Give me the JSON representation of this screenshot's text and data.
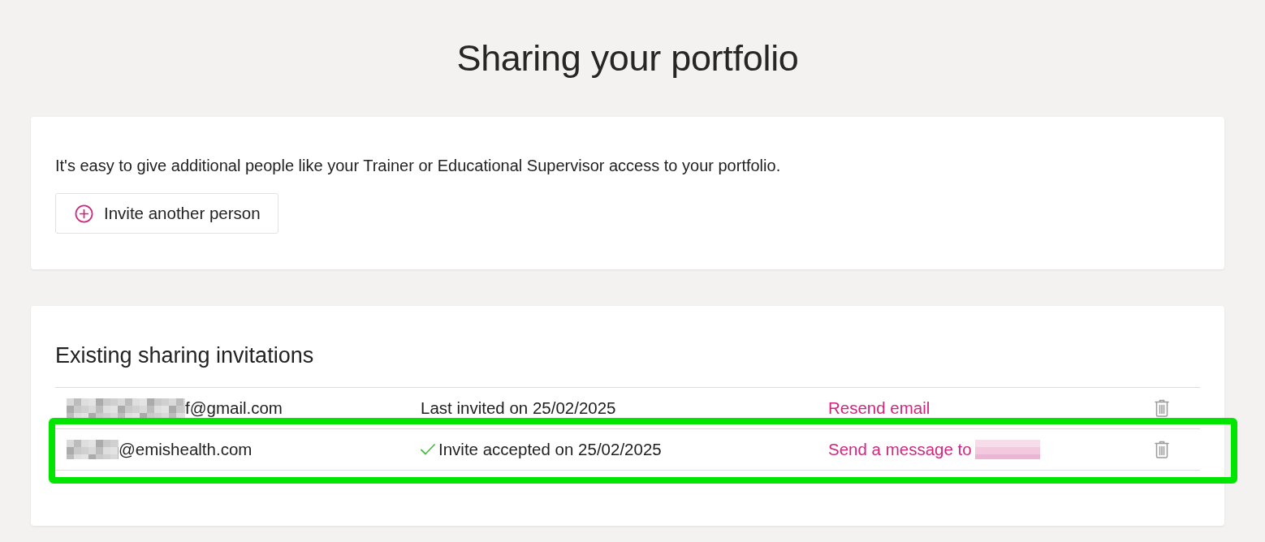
{
  "page": {
    "title": "Sharing your portfolio"
  },
  "intro_card": {
    "text": "It's easy to give additional people like your Trainer or Educational Supervisor access to your portfolio.",
    "invite_button": {
      "label": "Invite another person"
    }
  },
  "invitations": {
    "heading": "Existing sharing invitations",
    "rows": [
      {
        "email": "f@gmail.com",
        "email_redacted": true,
        "status": "Last invited on 25/02/2025",
        "accepted": false,
        "action": "Resend email",
        "action_redacted": false,
        "highlighted": false
      },
      {
        "email": "@emishealth.com",
        "email_redacted": true,
        "status": "Invite accepted on 25/02/2025",
        "accepted": true,
        "action": "Send a message to",
        "action_redacted": true,
        "highlighted": true
      }
    ]
  }
}
